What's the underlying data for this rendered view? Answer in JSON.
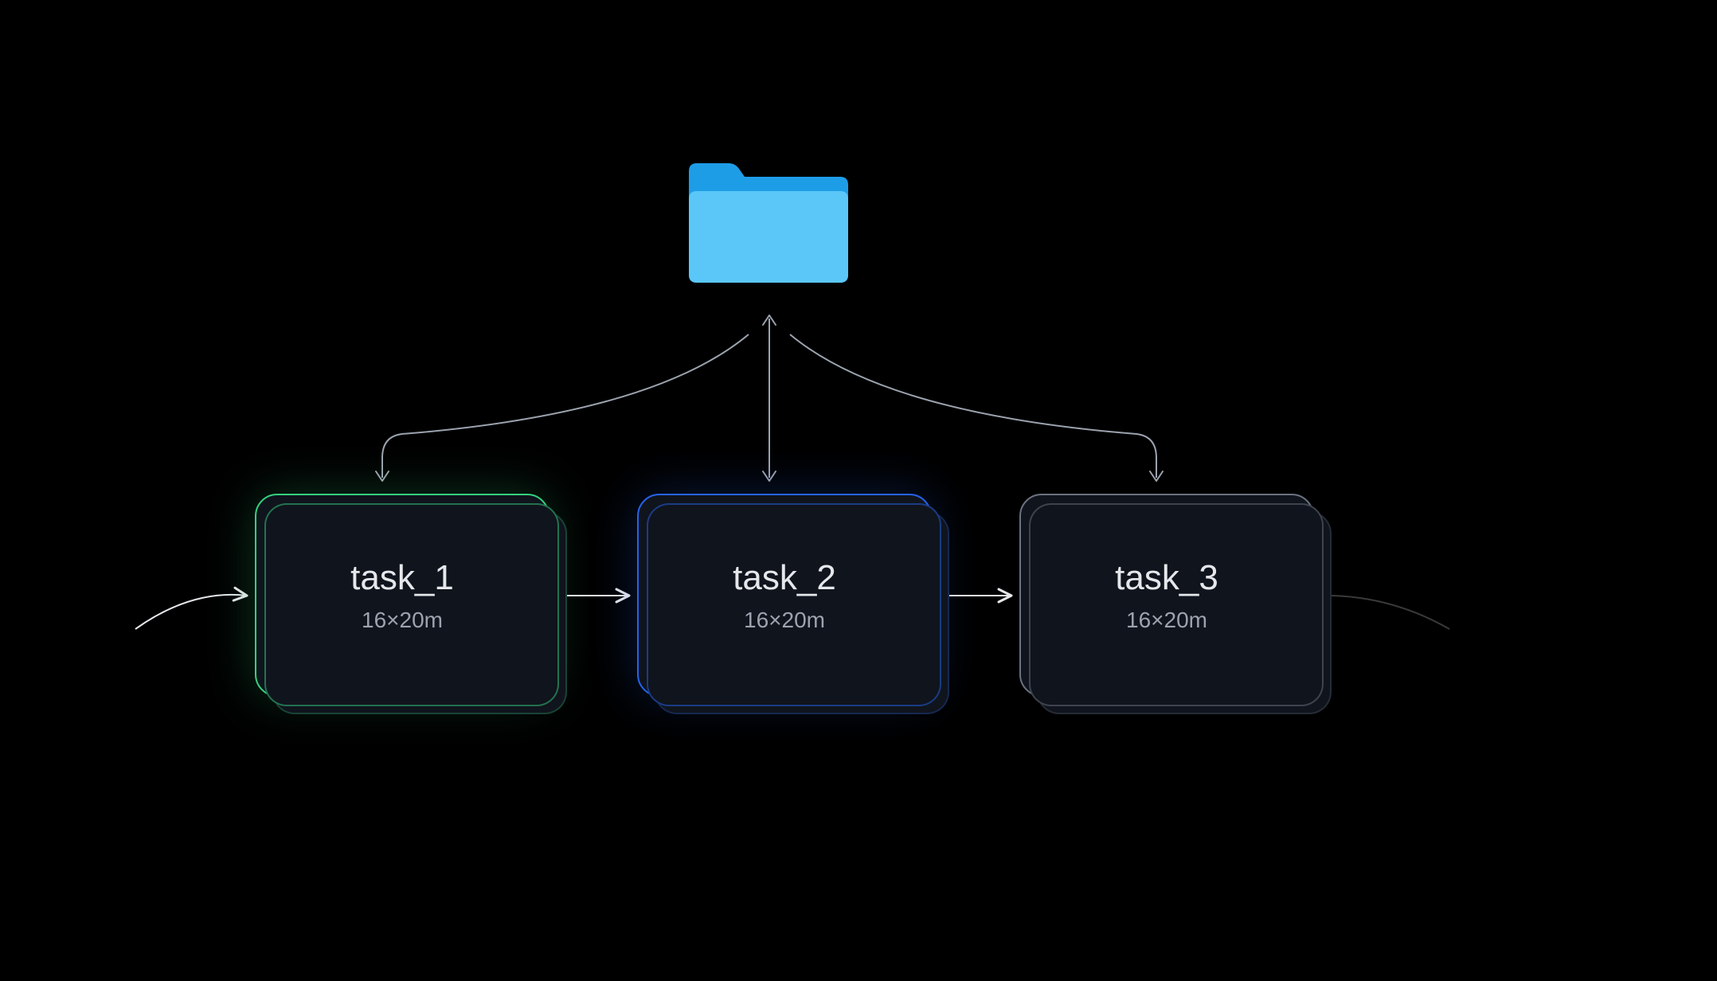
{
  "diagram": {
    "source_type": "folder",
    "tasks": [
      {
        "id": "task_1",
        "title": "task_1",
        "subtitle": "16×20m",
        "accent_color": "#35d07f"
      },
      {
        "id": "task_2",
        "title": "task_2",
        "subtitle": "16×20m",
        "accent_color": "#2563eb"
      },
      {
        "id": "task_3",
        "title": "task_3",
        "subtitle": "16×20m",
        "accent_color": "#6b7280"
      }
    ]
  }
}
